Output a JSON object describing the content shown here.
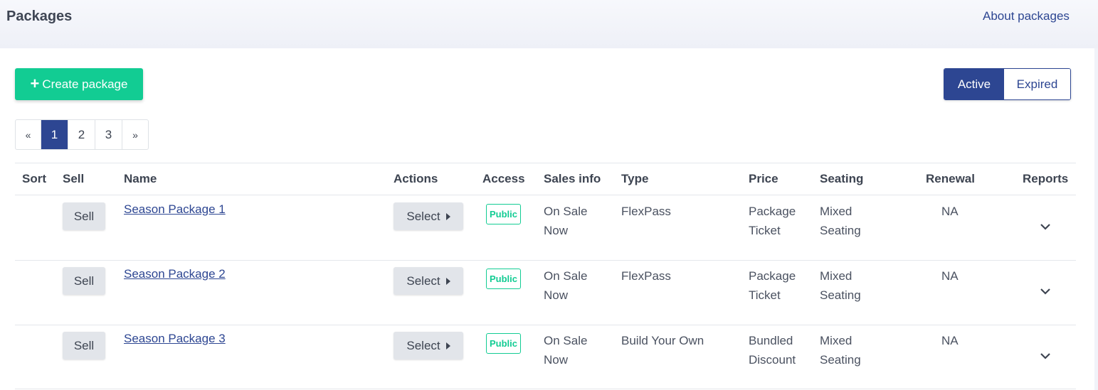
{
  "header": {
    "title": "Packages",
    "about_link": "About packages"
  },
  "toolbar": {
    "create_label": "Create package",
    "create_icon": "plus-icon",
    "filter": {
      "active": "Active",
      "expired": "Expired",
      "selected": "Active"
    }
  },
  "pagination": {
    "prev": "«",
    "next": "»",
    "pages": [
      "1",
      "2",
      "3"
    ],
    "current": "1"
  },
  "table": {
    "headers": {
      "sort": "Sort",
      "sell": "Sell",
      "name": "Name",
      "actions": "Actions",
      "access": "Access",
      "sales_info": "Sales info",
      "type": "Type",
      "price": "Price",
      "seating": "Seating",
      "renewal": "Renewal",
      "reports": "Reports"
    },
    "rows": [
      {
        "sell": "Sell",
        "name": "Season Package 1",
        "action": "Select",
        "access": "Public",
        "sales_1": "On Sale",
        "sales_2": "Now",
        "type": "FlexPass",
        "price_1": "Package",
        "price_2": "Ticket",
        "seating_1": "Mixed",
        "seating_2": "Seating",
        "renewal": "NA"
      },
      {
        "sell": "Sell",
        "name": "Season Package 2",
        "action": "Select",
        "access": "Public",
        "sales_1": "On Sale",
        "sales_2": "Now",
        "type": "FlexPass",
        "price_1": "Package",
        "price_2": "Ticket",
        "seating_1": "Mixed",
        "seating_2": "Seating",
        "renewal": "NA"
      },
      {
        "sell": "Sell",
        "name": "Season Package 3",
        "action": "Select",
        "access": "Public",
        "sales_1": "On Sale",
        "sales_2": "Now",
        "type": "Build Your Own",
        "price_1": "Bundled",
        "price_2": "Discount",
        "seating_1": "Mixed",
        "seating_2": "Seating",
        "renewal": "NA"
      }
    ]
  },
  "colors": {
    "primary": "#2d4692",
    "success": "#12cc93",
    "background": "#f1f3f9"
  }
}
